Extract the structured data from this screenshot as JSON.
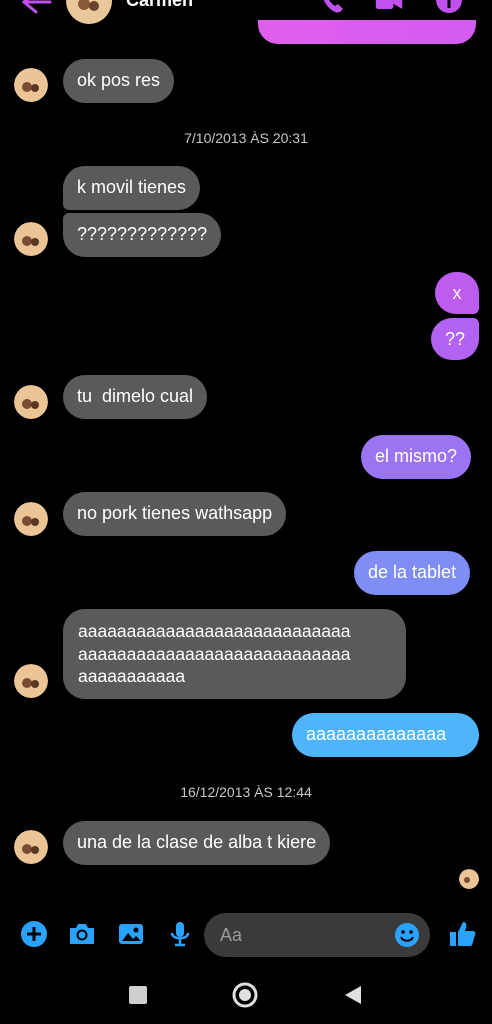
{
  "header": {
    "contact_name": "Carmen",
    "accent": "#c150f0"
  },
  "messages": [
    {
      "id": "m1",
      "direction": "in",
      "text": "ok pos res"
    },
    {
      "id": "ts1",
      "type": "timestamp",
      "text": "7/10/2013 ÀS 20:31"
    },
    {
      "id": "m2",
      "direction": "in",
      "text": "k movil tienes"
    },
    {
      "id": "m3",
      "direction": "in",
      "text": "?????????????"
    },
    {
      "id": "m4",
      "direction": "out",
      "text": "x"
    },
    {
      "id": "m5",
      "direction": "out",
      "text": "??"
    },
    {
      "id": "m6",
      "direction": "in",
      "text": "tu  dimelo cual"
    },
    {
      "id": "m7",
      "direction": "out",
      "text": "el mismo?"
    },
    {
      "id": "m8",
      "direction": "in",
      "text": "no pork tienes wathsapp"
    },
    {
      "id": "m9",
      "direction": "out",
      "text": "de la tablet"
    },
    {
      "id": "m10",
      "direction": "in",
      "text": "aaaaaaaaaaaaaaaaaaaaaaaaaaaa\naaaaaaaaaaaaaaaaaaaaaaaaaaaa\naaaaaaaaaaa"
    },
    {
      "id": "m11",
      "direction": "out",
      "text": "aaaaaaaaaaaaaa"
    },
    {
      "id": "ts2",
      "type": "timestamp",
      "text": "16/12/2013 ÀS 12:44"
    },
    {
      "id": "m12",
      "direction": "in",
      "text": "una de la clase de alba t kiere"
    }
  ],
  "composer": {
    "placeholder": "Aa",
    "icons": [
      "plus-icon",
      "camera-icon",
      "gallery-icon",
      "microphone-icon",
      "emoji-icon",
      "thumbs-up-icon"
    ],
    "icon_color": "#2aa3ff"
  },
  "colors": {
    "incoming_bubble": "#5a5a5a",
    "outgoing_gradient_top": "#c05cf0",
    "outgoing_gradient_bottom": "#49b6ff"
  }
}
